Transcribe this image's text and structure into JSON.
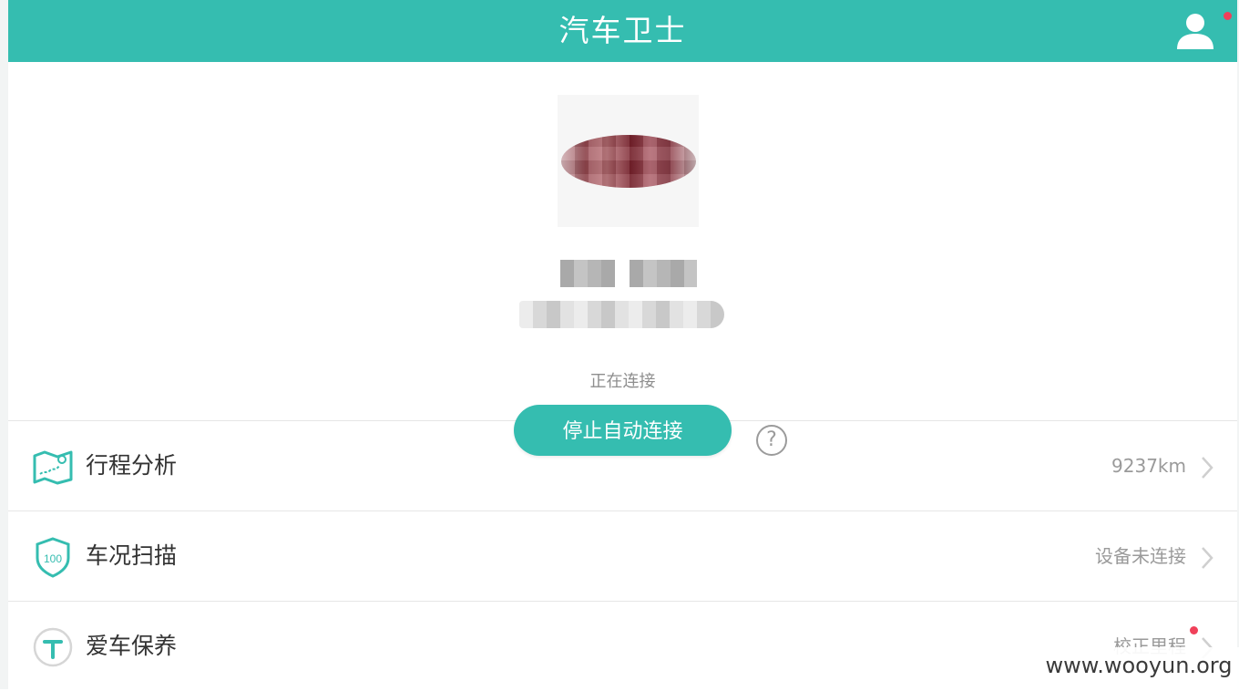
{
  "header": {
    "title": "汽车卫士",
    "user_icon": "user-icon",
    "notification": "red-dot"
  },
  "profile": {
    "status": "正在连接",
    "stop_button_label": "停止自动连接",
    "help_icon": "question-circle-icon",
    "help_glyph": "?"
  },
  "menu": {
    "items": [
      {
        "icon": "map-route-icon",
        "label": "行程分析",
        "value": "9237km"
      },
      {
        "icon": "shield-100-icon",
        "label": "车况扫描",
        "value": "设备未连接"
      },
      {
        "icon": "wrench-circle-icon",
        "label": "爱车保养",
        "value": "校正里程"
      }
    ]
  },
  "watermark": "www.wooyun.org",
  "colors": {
    "accent": "#35bdb0",
    "badge": "#f0405a",
    "text_primary": "#333333",
    "text_secondary": "#9a9a9a"
  }
}
